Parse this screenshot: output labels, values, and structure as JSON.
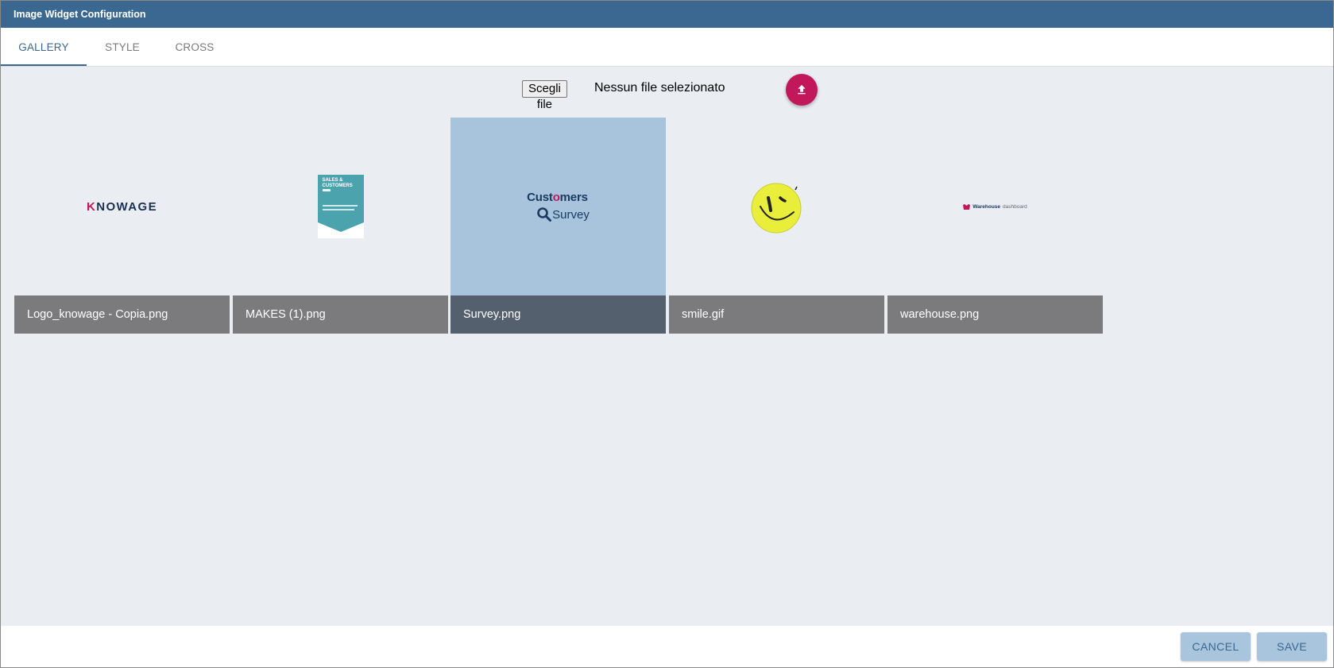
{
  "dialog": {
    "title": "Image Widget Configuration"
  },
  "tabs": [
    {
      "label": "GALLERY",
      "active": true
    },
    {
      "label": "STYLE",
      "active": false
    },
    {
      "label": "CROSS",
      "active": false
    }
  ],
  "upload": {
    "choose_label": "Scegli file",
    "status": "Nessun file selezionato",
    "icon": "upload-icon",
    "color": "#c2185b"
  },
  "gallery": {
    "items": [
      {
        "name": "Logo_knowage - Copia.png",
        "selected": false,
        "logo_text": "KNOWAGE"
      },
      {
        "name": "MAKES (1).png",
        "selected": false,
        "logo_text": "SALES & CUSTOMERS"
      },
      {
        "name": "Survey.png",
        "selected": true,
        "logo_text_1": "Customers",
        "logo_text_2": "Survey"
      },
      {
        "name": "smile.gif",
        "selected": false,
        "icon": "smiley-icon"
      },
      {
        "name": "warehouse.png",
        "selected": false,
        "logo_text_1": "Warehouse",
        "logo_text_2": "dashboard"
      }
    ]
  },
  "footer": {
    "cancel_label": "CANCEL",
    "save_label": "SAVE"
  },
  "colors": {
    "header": "#3b6890",
    "accent": "#c2185b",
    "selected_card": "#a8c3dc",
    "button": "#a9c4dd"
  }
}
